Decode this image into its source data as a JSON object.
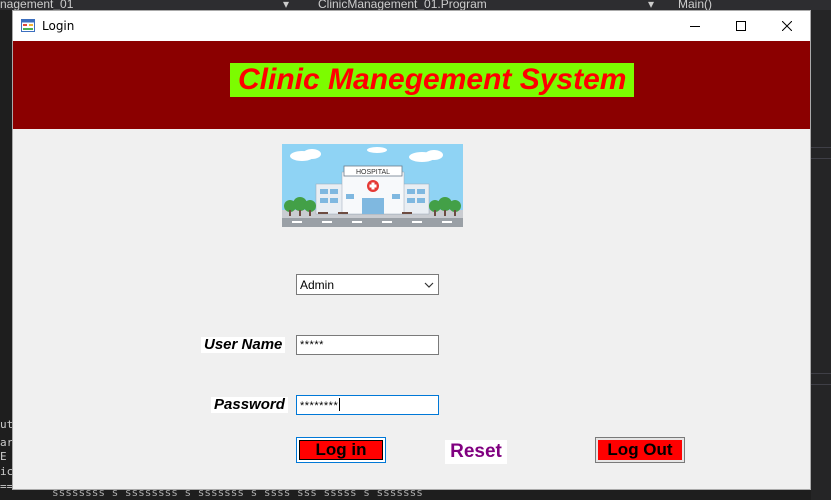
{
  "ide": {
    "tab_left": "nagement_01",
    "tab_mid": "ClinicManagement_01.Program",
    "tab_right": "Main()",
    "left_lines": [
      "ut",
      "ar",
      " E",
      "ic",
      "=="
    ],
    "bottom_text": "ssssssss s ssssssss s sssssss s ssss sss sssss s sssssss"
  },
  "window": {
    "title": "Login",
    "icons": {
      "app": "form-icon",
      "minimize": "minimize-icon",
      "maximize": "maximize-icon",
      "close": "close-icon"
    }
  },
  "header": {
    "title": "Clinic Manegement System",
    "band_color": "#8b0000",
    "title_bg": "#7cfc00",
    "title_color": "#ff0000"
  },
  "hospital_image": {
    "sign": "HOSPITAL"
  },
  "form": {
    "role": {
      "value": "Admin"
    },
    "username": {
      "label": "User Name",
      "value": "*****"
    },
    "password": {
      "label": "Password",
      "value": "********"
    }
  },
  "buttons": {
    "login": "Log in",
    "reset": "Reset",
    "logout": "Log Out"
  }
}
